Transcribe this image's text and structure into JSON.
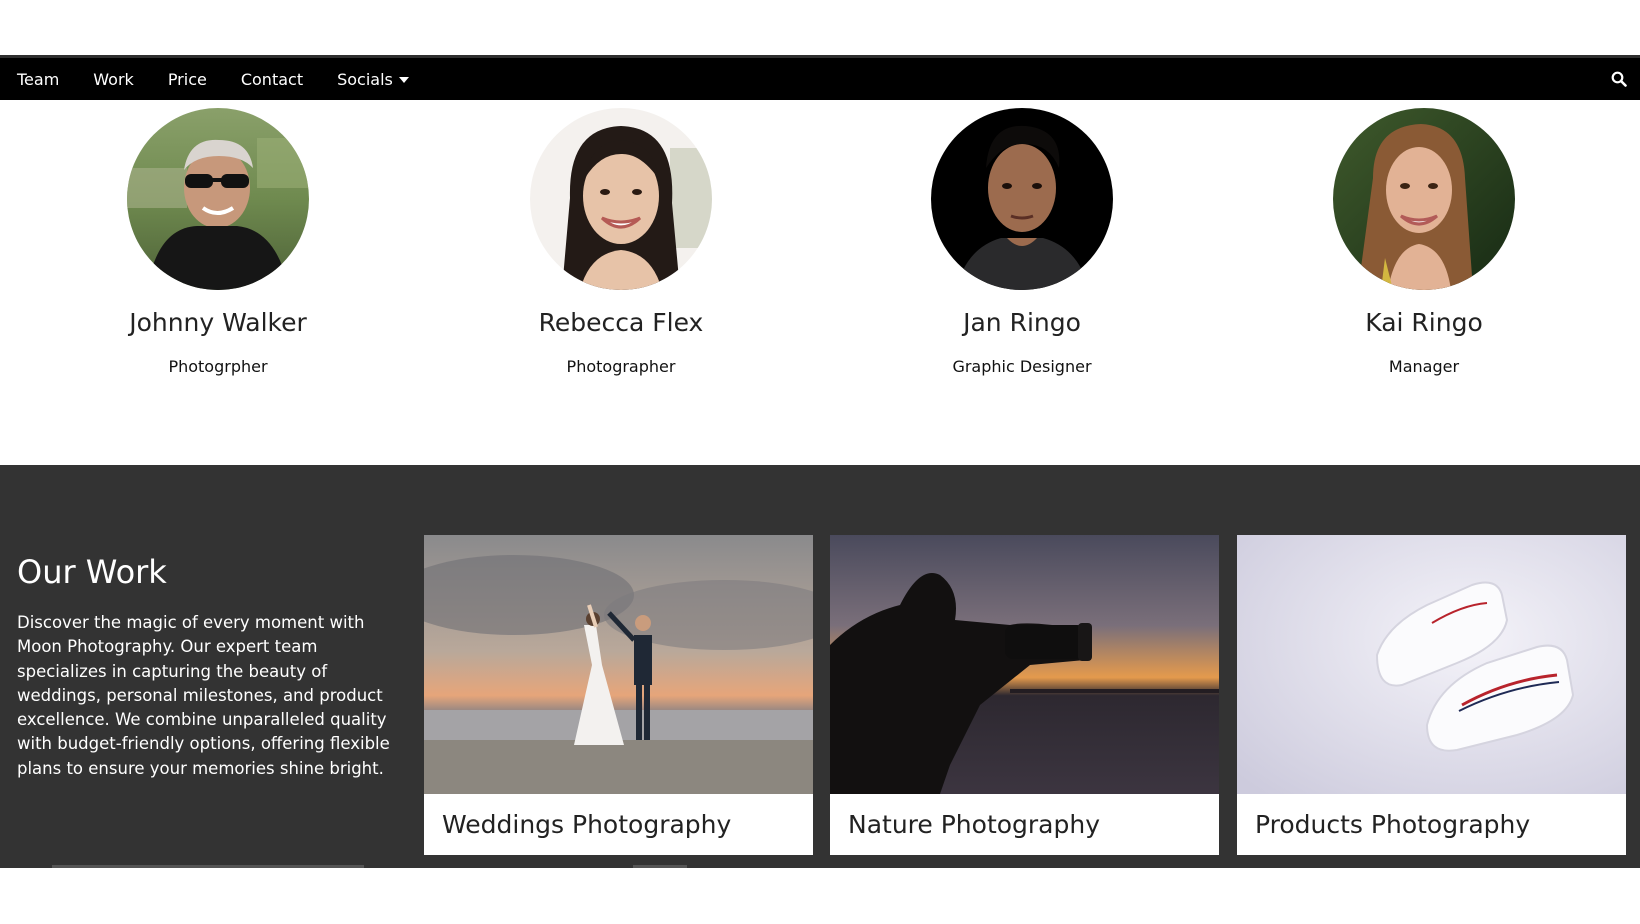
{
  "nav": {
    "items": [
      "Team",
      "Work",
      "Price",
      "Contact"
    ],
    "socials_label": "Socials",
    "search_icon": "search-icon"
  },
  "team": {
    "members": [
      {
        "name": "Johnny Walker",
        "role": "Photogrpher"
      },
      {
        "name": "Rebecca Flex",
        "role": "Photographer"
      },
      {
        "name": "Jan Ringo",
        "role": "Graphic Designer"
      },
      {
        "name": "Kai Ringo",
        "role": "Manager"
      }
    ]
  },
  "work": {
    "title": "Our Work",
    "description": "Discover the magic of every moment with Moon Photography. Our expert team specializes in capturing the beauty of weddings, personal milestones, and product excellence. We combine unparalleled quality with budget-friendly options, offering flexible plans to ensure your memories shine bright.",
    "cards": [
      {
        "label": "Weddings Photography"
      },
      {
        "label": "Nature Photography"
      },
      {
        "label": "Products Photography"
      }
    ]
  },
  "colors": {
    "navbar": "#000000",
    "work_background": "#333333",
    "text_light": "#ffffff"
  }
}
